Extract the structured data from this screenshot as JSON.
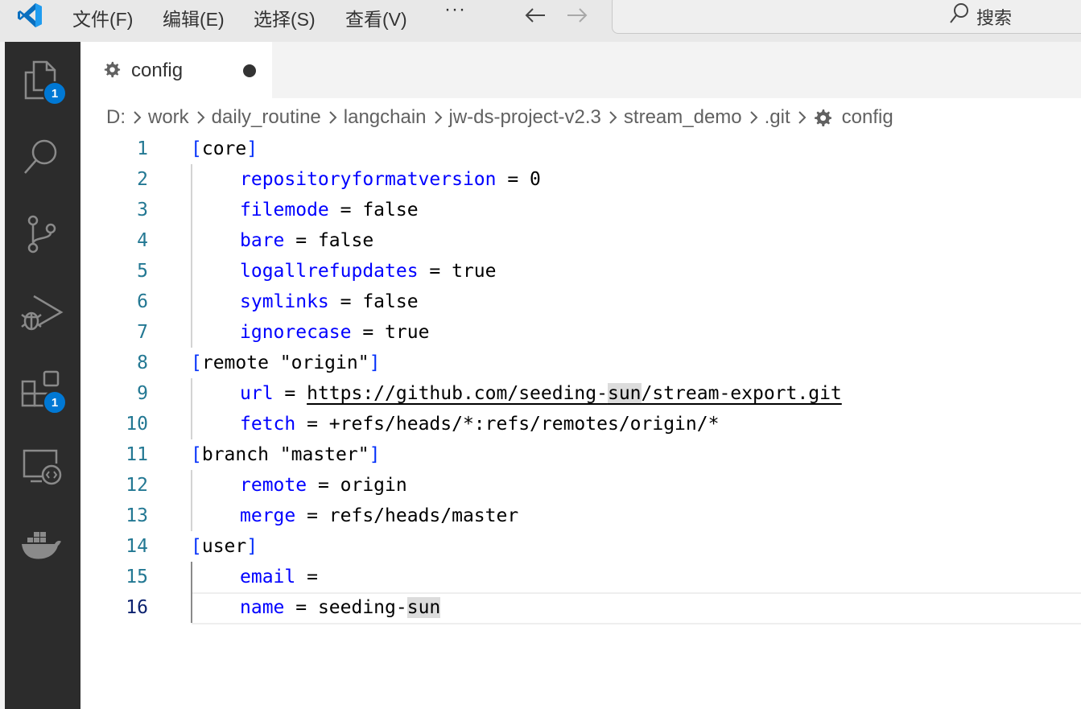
{
  "titlebar": {
    "menus": [
      "文件(F)",
      "编辑(E)",
      "选择(S)",
      "查看(V)"
    ],
    "more": "···",
    "back_icon": "arrow-left-icon",
    "forward_icon": "arrow-right-icon",
    "search_label": "搜索"
  },
  "activity_bar": {
    "items": [
      {
        "name": "explorer",
        "icon": "files-icon",
        "badge": "1"
      },
      {
        "name": "search",
        "icon": "search-icon"
      },
      {
        "name": "source-control",
        "icon": "source-control-icon"
      },
      {
        "name": "run-debug",
        "icon": "debug-icon"
      },
      {
        "name": "extensions",
        "icon": "extensions-icon",
        "badge": "1"
      },
      {
        "name": "remote-explorer",
        "icon": "remote-explorer-icon"
      },
      {
        "name": "docker",
        "icon": "docker-icon"
      }
    ]
  },
  "tabs": [
    {
      "label": "config",
      "icon": "gear-icon",
      "dirty": true
    }
  ],
  "breadcrumb": [
    "D:",
    "work",
    "daily_routine",
    "langchain",
    "jw-ds-project-v2.3",
    "stream_demo",
    ".git",
    "config"
  ],
  "editor": {
    "current_line": 16,
    "lines": [
      {
        "n": "1",
        "section": "core"
      },
      {
        "n": "2",
        "key": "repositoryformatversion",
        "op": " = ",
        "value": "0"
      },
      {
        "n": "3",
        "key": "filemode",
        "op": " = ",
        "value": "false"
      },
      {
        "n": "4",
        "key": "bare",
        "op": " = ",
        "value": "false"
      },
      {
        "n": "5",
        "key": "logallrefupdates",
        "op": " = ",
        "value": "true"
      },
      {
        "n": "6",
        "key": "symlinks",
        "op": " = ",
        "value": "false"
      },
      {
        "n": "7",
        "key": "ignorecase",
        "op": " = ",
        "value": "true"
      },
      {
        "n": "8",
        "section": "remote \"origin\""
      },
      {
        "n": "9",
        "key": "url",
        "op": " = ",
        "value_pre": "https://github.com/seeding-",
        "value_hl": "sun",
        "value_post": "/stream-export.git"
      },
      {
        "n": "10",
        "key": "fetch",
        "op": " = ",
        "value": "+refs/heads/*:refs/remotes/origin/*"
      },
      {
        "n": "11",
        "section": "branch \"master\""
      },
      {
        "n": "12",
        "key": "remote",
        "op": " = ",
        "value": "origin"
      },
      {
        "n": "13",
        "key": "merge",
        "op": " = ",
        "value": "refs/heads/master"
      },
      {
        "n": "14",
        "section": "user"
      },
      {
        "n": "15",
        "key": "email",
        "op": " =",
        "value": ""
      },
      {
        "n": "16",
        "key": "name",
        "op": " = ",
        "value_pre": "seeding-",
        "value_hl": "sun",
        "value_post": ""
      }
    ]
  },
  "colors": {
    "activity_bar": "#2c2c2c",
    "badge": "#0078d4",
    "line_number": "#237893",
    "key": "#0000ff",
    "word_highlight": "#dcdcdc"
  }
}
